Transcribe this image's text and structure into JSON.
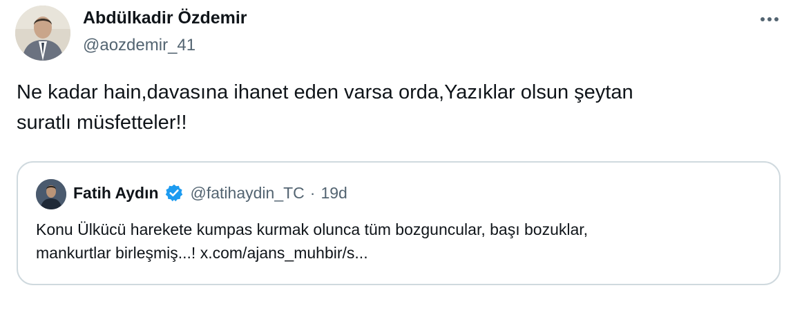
{
  "tweet": {
    "author_name": "Abdülkadir Özdemir",
    "author_handle": "@aozdemir_41",
    "more_icon": "more-horizontal-icon",
    "text": "Ne kadar hain,davasına ihanet eden varsa orda,Yazıklar olsun şeytan\nsuratlı müsfetteler!!"
  },
  "quote": {
    "author_name": "Fatih Aydın",
    "verified_icon": "verified-badge-icon",
    "author_handle": "@fatihaydin_TC",
    "separator": "·",
    "time": "19d",
    "text": "Konu Ülkücü harekete kumpas kurmak olunca tüm bozguncular, başı bozuklar,\nmankurtlar birleşmiş...! x.com/ajans_muhbir/s..."
  },
  "colors": {
    "primary_text": "#0f1419",
    "secondary_text": "#536471",
    "border": "#cfd9de",
    "verified": "#1d9bf0"
  }
}
